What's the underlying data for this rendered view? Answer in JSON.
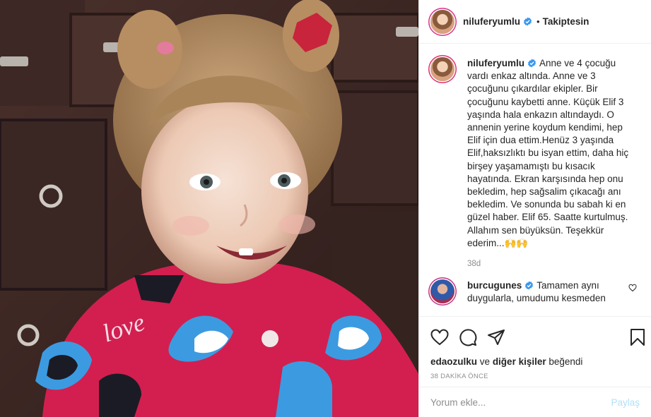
{
  "post": {
    "username": "niluferyumlu",
    "follow_status": "Takiptesin",
    "caption": "Anne ve 4 çocuğu vardı enkaz altında. Anne ve 3 çocuğunu çıkardılar ekipler. Bir çocuğunu kaybetti anne. Küçük Elif 3 yaşında hala enkazın altındaydı. O annenin yerine koydum kendimi, hep Elif için dua ettim.Henüz 3 yaşında Elif,haksızlıktı bu isyan ettim, daha hiç birşey yaşamamıştı bu kısacık hayatında. Ekran karşısında hep onu bekledim, hep sağsalim çıkacağı anı bekledim. Ve sonunda bu sabah ki en güzel haber. Elif 65. Saatte kurtulmuş. Allahım sen büyüksün. Teşekkür ederim...🙌🙌",
    "caption_age": "38d"
  },
  "comment": {
    "username": "burcugunes",
    "text": "Tamamen aynı duygularla, umudumu kesmeden"
  },
  "likes": {
    "user": "edaozulku",
    "connector": "ve",
    "others": "diğer kişiler",
    "suffix": "beğendi"
  },
  "post_time": "38 DAKİKA ÖNCE",
  "add_comment": {
    "placeholder": "Yorum ekle...",
    "post_label": "Paylaş"
  },
  "icons": [
    "heart-icon",
    "comment-icon",
    "share-icon",
    "bookmark-icon",
    "verified-icon",
    "small-heart-icon"
  ],
  "colors": {
    "verified": "#3897f0",
    "post_button": "#b2dffc",
    "secondary_text": "#8e8e8e",
    "sweater": "#d21f4f",
    "heart_patch": "#3c9be0"
  }
}
